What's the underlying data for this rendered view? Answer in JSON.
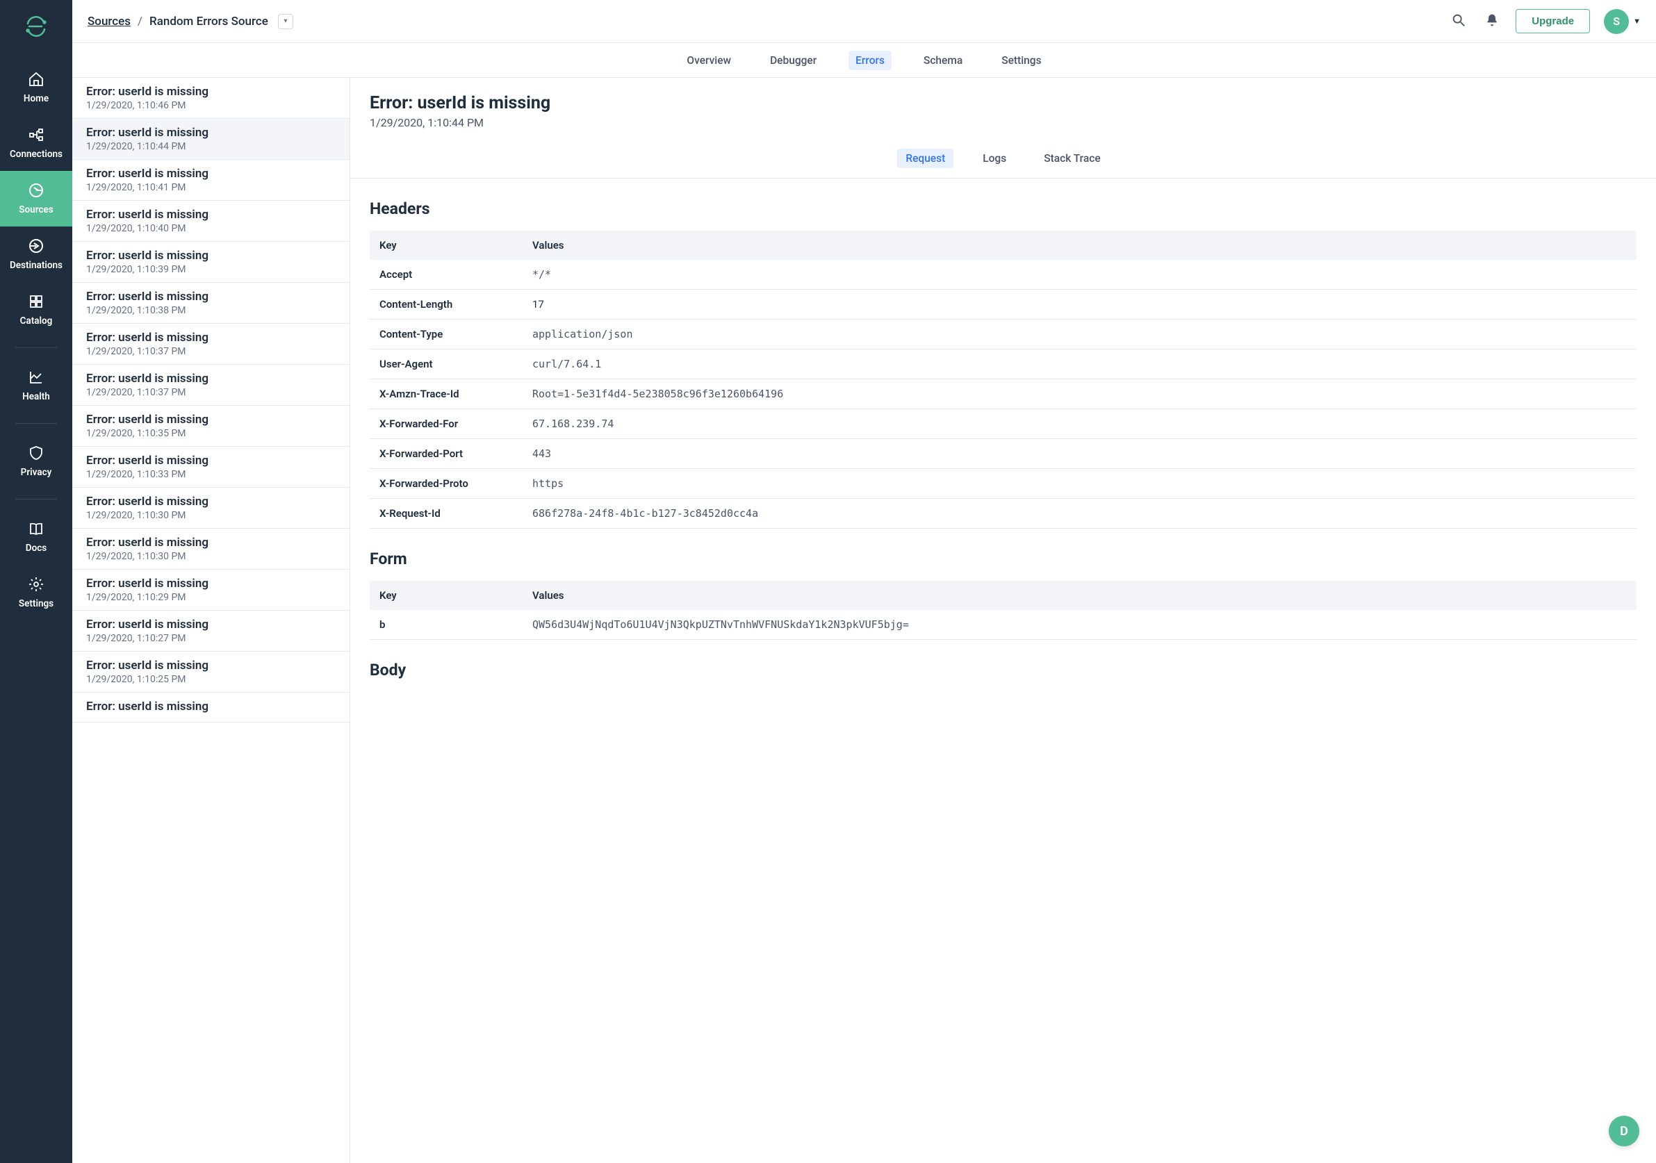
{
  "breadcrumb": {
    "root": "Sources",
    "current": "Random Errors Source"
  },
  "topbar": {
    "upgrade": "Upgrade",
    "avatar_letter": "S"
  },
  "sidebar": {
    "items": [
      {
        "label": "Home"
      },
      {
        "label": "Connections"
      },
      {
        "label": "Sources"
      },
      {
        "label": "Destinations"
      },
      {
        "label": "Catalog"
      },
      {
        "label": "Health"
      },
      {
        "label": "Privacy"
      },
      {
        "label": "Docs"
      },
      {
        "label": "Settings"
      }
    ]
  },
  "tabs": [
    {
      "label": "Overview"
    },
    {
      "label": "Debugger"
    },
    {
      "label": "Errors"
    },
    {
      "label": "Schema"
    },
    {
      "label": "Settings"
    }
  ],
  "error_list": [
    {
      "title": "Error: userId is missing",
      "ts": "1/29/2020, 1:10:46 PM"
    },
    {
      "title": "Error: userId is missing",
      "ts": "1/29/2020, 1:10:44 PM"
    },
    {
      "title": "Error: userId is missing",
      "ts": "1/29/2020, 1:10:41 PM"
    },
    {
      "title": "Error: userId is missing",
      "ts": "1/29/2020, 1:10:40 PM"
    },
    {
      "title": "Error: userId is missing",
      "ts": "1/29/2020, 1:10:39 PM"
    },
    {
      "title": "Error: userId is missing",
      "ts": "1/29/2020, 1:10:38 PM"
    },
    {
      "title": "Error: userId is missing",
      "ts": "1/29/2020, 1:10:37 PM"
    },
    {
      "title": "Error: userId is missing",
      "ts": "1/29/2020, 1:10:37 PM"
    },
    {
      "title": "Error: userId is missing",
      "ts": "1/29/2020, 1:10:35 PM"
    },
    {
      "title": "Error: userId is missing",
      "ts": "1/29/2020, 1:10:33 PM"
    },
    {
      "title": "Error: userId is missing",
      "ts": "1/29/2020, 1:10:30 PM"
    },
    {
      "title": "Error: userId is missing",
      "ts": "1/29/2020, 1:10:30 PM"
    },
    {
      "title": "Error: userId is missing",
      "ts": "1/29/2020, 1:10:29 PM"
    },
    {
      "title": "Error: userId is missing",
      "ts": "1/29/2020, 1:10:27 PM"
    },
    {
      "title": "Error: userId is missing",
      "ts": "1/29/2020, 1:10:25 PM"
    },
    {
      "title": "Error: userId is missing",
      "ts": ""
    }
  ],
  "detail": {
    "title": "Error: userId is missing",
    "ts": "1/29/2020, 1:10:44 PM",
    "tabs": [
      {
        "label": "Request"
      },
      {
        "label": "Logs"
      },
      {
        "label": "Stack Trace"
      }
    ],
    "sections": {
      "headers_title": "Headers",
      "form_title": "Form",
      "body_title": "Body",
      "th_key": "Key",
      "th_values": "Values"
    },
    "headers": [
      {
        "k": "Accept",
        "v": "*/*",
        "mono": true
      },
      {
        "k": "Content-Length",
        "v": "17",
        "mono": false
      },
      {
        "k": "Content-Type",
        "v": "application/json",
        "mono": true
      },
      {
        "k": "User-Agent",
        "v": "curl/7.64.1",
        "mono": true
      },
      {
        "k": "X-Amzn-Trace-Id",
        "v": "Root=1-5e31f4d4-5e238058c96f3e1260b64196",
        "mono": true
      },
      {
        "k": "X-Forwarded-For",
        "v": "67.168.239.74",
        "mono": true
      },
      {
        "k": "X-Forwarded-Port",
        "v": "443",
        "mono": true
      },
      {
        "k": "X-Forwarded-Proto",
        "v": "https",
        "mono": true
      },
      {
        "k": "X-Request-Id",
        "v": "686f278a-24f8-4b1c-b127-3c8452d0cc4a",
        "mono": true
      }
    ],
    "form": [
      {
        "k": "b",
        "v": "QW56d3U4WjNqdTo6U1U4VjN3QkpUZTNvTnhWVFNUSkdaY1k2N3pkVUF5bjg=",
        "mono": true
      }
    ]
  },
  "fab_letter": "D"
}
